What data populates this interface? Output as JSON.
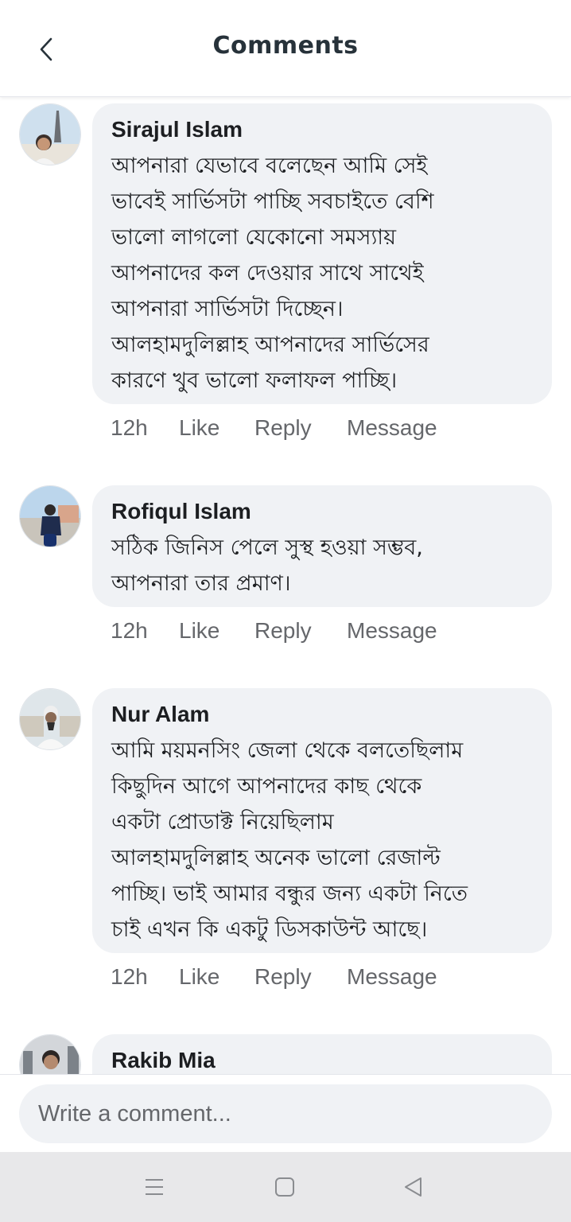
{
  "header": {
    "title": "Comments"
  },
  "comments": [
    {
      "author": "Sirajul Islam",
      "lines": [
        "আপনারা যেভাবে বলেছেন আমি সেই",
        "ভাবেই সার্ভিসটা পাচ্ছি সবচাইতে বেশি",
        "ভালো লাগলো যেকোনো সমস্যায়",
        "আপনাদের কল দেওয়ার সাথে সাথেই",
        "আপনারা সার্ভিসটা দিচ্ছেন।",
        "আলহামদুলিল্লাহ আপনাদের সার্ভিসের",
        "কারণে খুব ভালো ফলাফল পাচ্ছি।"
      ],
      "time": "12h",
      "like": "Like",
      "reply": "Reply",
      "message": "Message"
    },
    {
      "author": "Rofiqul Islam",
      "lines": [
        "সঠিক জিনিস পেলে সুস্থ হওয়া সম্ভব,",
        "আপনারা তার প্রমাণ।"
      ],
      "time": "12h",
      "like": "Like",
      "reply": "Reply",
      "message": "Message"
    },
    {
      "author": "Nur Alam",
      "lines": [
        "আমি ময়মনসিং জেলা থেকে বলতেছিলাম",
        "কিছুদিন আগে আপনাদের কাছ থেকে",
        "একটা প্রোডাক্ট নিয়েছিলাম",
        "আলহামদুলিল্লাহ অনেক ভালো রেজাল্ট",
        "পাচ্ছি। ভাই আমার বন্ধুর জন্য একটা নিতে",
        "চাই এখন কি একটু ডিসকাউন্ট আছে।"
      ],
      "time": "12h",
      "like": "Like",
      "reply": "Reply",
      "message": "Message"
    },
    {
      "author": "Rakib Mia"
    }
  ],
  "composer": {
    "placeholder": "Write a comment..."
  },
  "icons": {
    "back": "chevron-left-icon",
    "nav_menu": "menu-lines-icon",
    "nav_home": "square-home-icon",
    "nav_back": "triangle-back-icon"
  }
}
